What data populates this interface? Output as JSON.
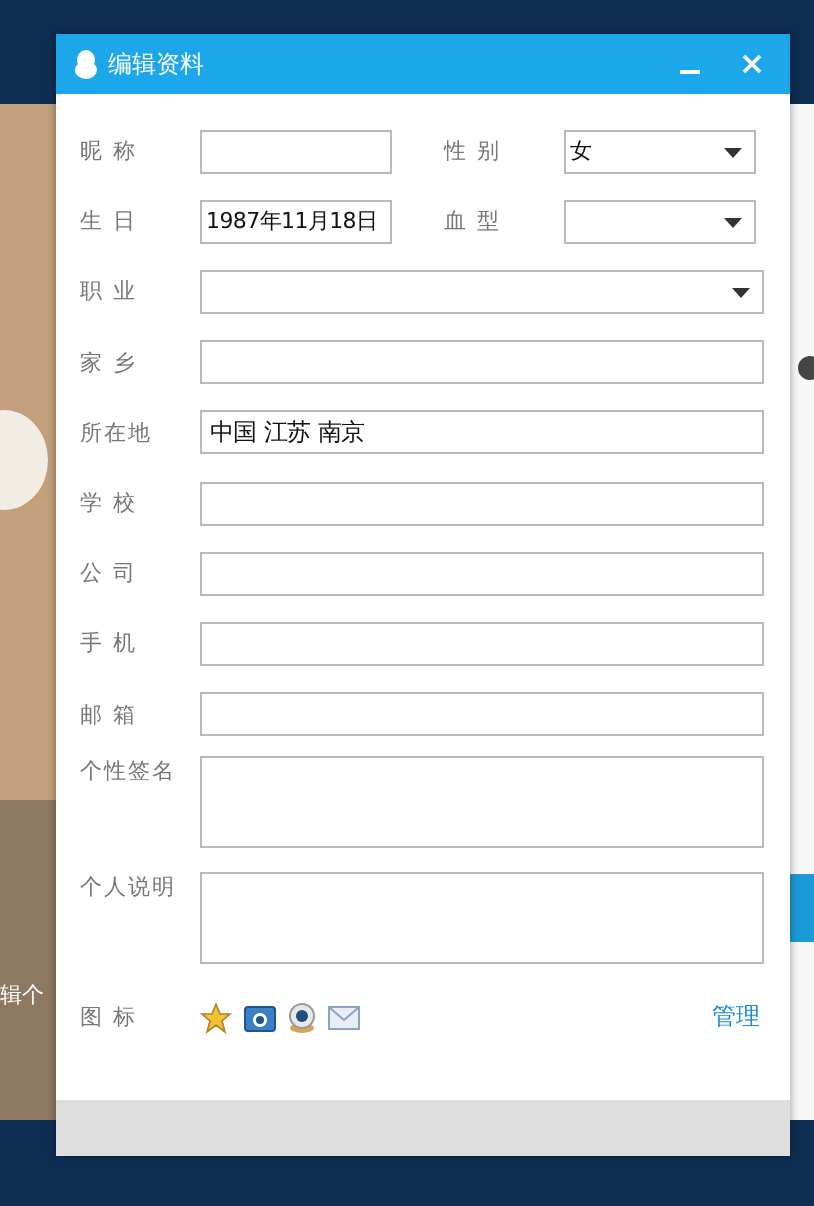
{
  "window": {
    "title": "编辑资料"
  },
  "rows": [
    {
      "fields": [
        {
          "label": "昵 称",
          "kind": "text"
        },
        {
          "label": "性 别",
          "kind": "select",
          "value": "女"
        }
      ]
    },
    {
      "fields": [
        {
          "label": "生 日",
          "kind": "text",
          "value": "1987年11月18日"
        },
        {
          "label": "血 型",
          "kind": "select"
        }
      ]
    },
    {
      "fields": [
        {
          "label": "职 业",
          "kind": "select"
        }
      ]
    },
    {
      "fields": [
        {
          "label": "家 乡",
          "kind": "text"
        }
      ]
    },
    {
      "fields": [
        {
          "label": "所在地",
          "kind": "text",
          "value": "中国  江苏  南京"
        }
      ]
    },
    {
      "fields": [
        {
          "label": "学 校",
          "kind": "text"
        }
      ]
    },
    {
      "fields": [
        {
          "label": "公 司",
          "kind": "text"
        }
      ]
    },
    {
      "fields": [
        {
          "label": "手 机",
          "kind": "text"
        }
      ]
    },
    {
      "fields": [
        {
          "label": "邮 箱",
          "kind": "text"
        }
      ]
    },
    {
      "fields": [
        {
          "label": "个性签名",
          "kind": "textarea"
        }
      ]
    },
    {
      "fields": [
        {
          "label": "个人说明",
          "kind": "textarea"
        }
      ]
    }
  ],
  "icons_row": {
    "label": "图 标",
    "link": "管理"
  },
  "background_texts": [
    "辑个"
  ]
}
